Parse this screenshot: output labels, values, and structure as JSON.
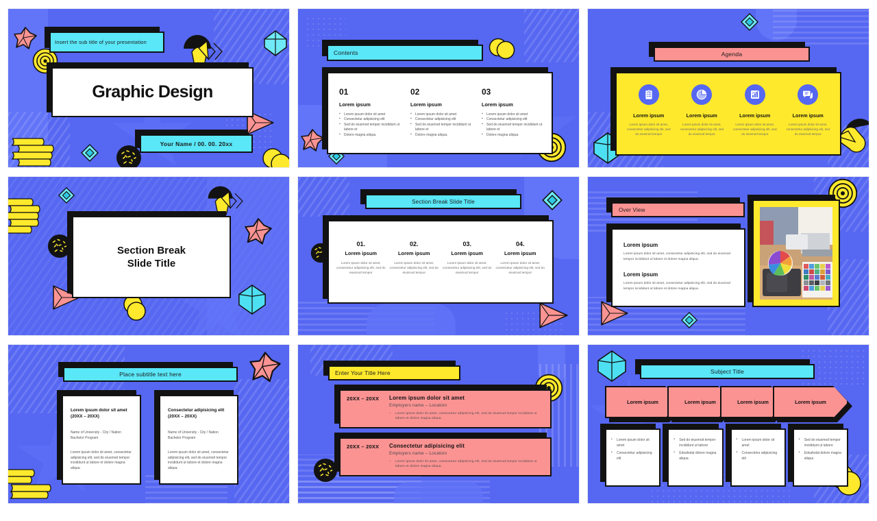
{
  "deck": {
    "title": "Graphic Design Presentation Template",
    "colors": {
      "background_blue": "#5667f2",
      "accent_cyan": "#5ae7f7",
      "accent_pink": "#fc9393",
      "accent_yellow": "#ffe92c",
      "ink_black": "#121212",
      "card_white": "#ffffff"
    }
  },
  "slides": [
    {
      "id": "title-slide",
      "subtitle": "Insert the sub title of your presentation",
      "title": "Graphic Design",
      "byline": "Your Name  /  00. 00. 20xx"
    },
    {
      "id": "contents-slide",
      "heading": "Contents",
      "columns": [
        {
          "number": "01",
          "label": "Lorem ipsum",
          "bullets": [
            "Lorem ipsum dolor sit amet",
            "Consectetur adipisicing elit",
            "Sed do eiusmod tempor incididunt ut labore et",
            "Dolore magna aliqua."
          ]
        },
        {
          "number": "02",
          "label": "Lorem ipsum",
          "bullets": [
            "Lorem ipsum dolor sit amet",
            "Consectetur adipisicing elit",
            "Sed do eiusmod tempor incididunt ut labore et",
            "Dolore magna aliqua."
          ]
        },
        {
          "number": "03",
          "label": "Lorem ipsum",
          "bullets": [
            "Lorem ipsum dolor sit amet",
            "Consectetur adipisicing elit",
            "Sed do eiusmod tempor incididunt ut labore et",
            "Dolore magna aliqua."
          ]
        }
      ]
    },
    {
      "id": "agenda-slide",
      "heading": "Agenda",
      "items": [
        {
          "icon": "clipboard-list-icon",
          "label": "Lorem ipsum",
          "text": "Lorem ipsum dolor sit amet, consectetur adipisicing elit, sed do eiusmod tempor"
        },
        {
          "icon": "pie-chart-icon",
          "label": "Lorem ipsum",
          "text": "Lorem ipsum dolor sit amet, consectetur adipisicing elit, sed do eiusmod tempor"
        },
        {
          "icon": "bar-chart-icon",
          "label": "Lorem ipsum",
          "text": "Lorem ipsum dolor sit amet, consectetur adipisicing elit, sed do eiusmod tempor"
        },
        {
          "icon": "speech-bubble-icon",
          "label": "Lorem ipsum",
          "text": "Lorem ipsum dolor sit amet, consectetur adipisicing elit, sed do eiusmod tempor"
        }
      ]
    },
    {
      "id": "section-break-slide",
      "line1": "Section Break",
      "line2": "Slide Title"
    },
    {
      "id": "section-break-columns-slide",
      "heading": "Section Break Slide Title",
      "columns": [
        {
          "number": "01.",
          "label": "Lorem ipsum",
          "text": "Lorem ipsum dolor sit amet, consectetur adipisicing elit, sed do eiusmod tempor"
        },
        {
          "number": "02.",
          "label": "Lorem ipsum",
          "text": "Lorem ipsum dolor sit amet, consectetur adipisicing elit, sed do eiusmod tempor"
        },
        {
          "number": "03.",
          "label": "Lorem ipsum",
          "text": "Lorem ipsum dolor sit amet, consectetur adipisicing elit, sed do eiusmod tempor"
        },
        {
          "number": "04.",
          "label": "Lorem ipsum",
          "text": "Lorem ipsum dolor sit amet, consectetur adipisicing elit, sed do eiusmod tempor"
        }
      ]
    },
    {
      "id": "over-view-slide",
      "heading": "Over View",
      "blocks": [
        {
          "label": "Lorem ipsum",
          "text": "Lorem ipsum dolor sit amet, consectetur adipisicing elit, sed do eiusmod tempor incididunt ut labore et dolore magna aliqua."
        },
        {
          "label": "Lorem ipsum",
          "text": "Lorem ipsum dolor sit amet, consectetur adipisicing elit, sed do eiusmod tempor incididunt ut labore et dolore magna aliqua."
        }
      ],
      "photo_alt": "designer-at-desk-with-color-swatches-photo"
    },
    {
      "id": "education-slide",
      "heading": "Place subtitle text here",
      "cards": [
        {
          "title": "Lorem ipsum dolor sit amet (20XX – 20XX)",
          "meta": "Name of University - City / Nation Bachelor Program",
          "text": "Lorem ipsum dolor sit amet, consectetur adipisicing elit, sed do eiusmod tempor incididunt ut labore et dolore magna aliqua."
        },
        {
          "title": "Consectetur adipisicing elit (20XX – 20XX)",
          "meta": "Name of University - City / Nation Bachelor Program",
          "text": "Lorem ipsum dolor sit amet, consectetur adipisicing elit, sed do eiusmod tempor incididunt ut labore et dolore magna aliqua."
        }
      ]
    },
    {
      "id": "experience-slide",
      "heading": "Enter Your Title Here",
      "rows": [
        {
          "years": "20XX – 20XX",
          "title": "Lorem ipsum dolor sit amet",
          "subtitle": "Employers name – Location",
          "bullet": "Lorem ipsum dolor sit amet, consectetur adipisicing elit, sed do eiusmod tempor incididunt ut labore et dolore magna aliqua."
        },
        {
          "years": "20XX – 20XX",
          "title": "Consectetur adipisicing elit",
          "subtitle": "Employers name – Location",
          "bullet": "Lorem ipsum dolor sit amet, consectetur adipisicing elit, sed do eiusmod tempor incididunt ut labore et dolore magna aliqua."
        }
      ]
    },
    {
      "id": "subject-title-slide",
      "heading": "Subject Title",
      "steps": [
        {
          "label": "Lorem ipsum",
          "bullets": [
            "Lorem ipsum dolor sit amet",
            "Consectetur adipisicing elit"
          ]
        },
        {
          "label": "Lorem ipsum",
          "bullets": [
            "Sed do eiusmod tempor incididunt ut labore",
            "Edsafsdat dolore magna aliqua"
          ]
        },
        {
          "label": "Lorem ipsum",
          "bullets": [
            "Lorem ipsum dolor sit amet",
            "Consectetur adipisicing elit"
          ]
        },
        {
          "label": "Lorem ipsum",
          "bullets": [
            "Sed do eiusmod tempor incididunt ut labore",
            "Edsafsdat dolore magna aliqua"
          ]
        }
      ]
    }
  ]
}
